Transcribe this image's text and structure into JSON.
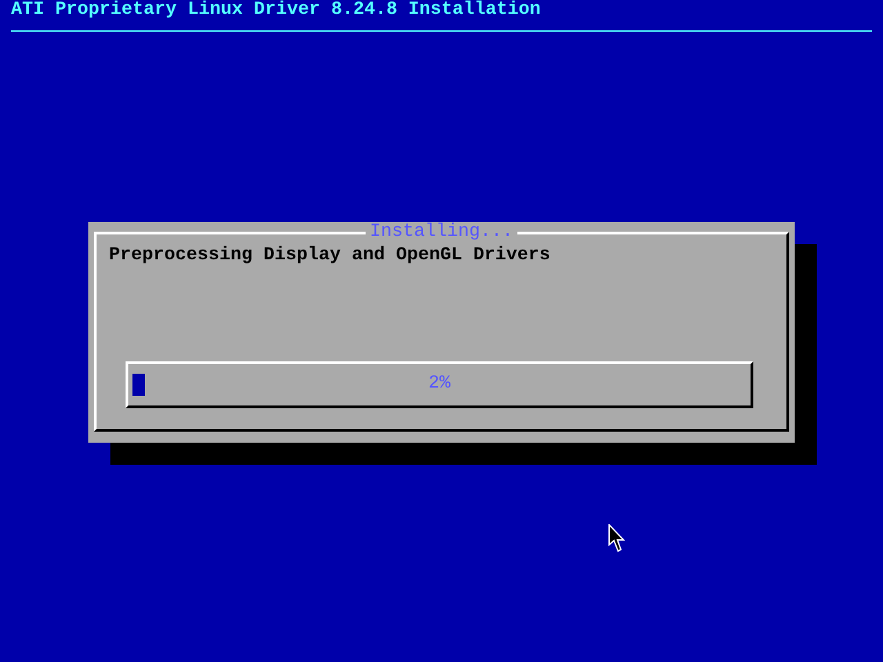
{
  "screen": {
    "title": "ATI Proprietary Linux Driver 8.24.8 Installation"
  },
  "dialog": {
    "title": "Installing...",
    "message": "Preprocessing Display and OpenGL Drivers",
    "progress": {
      "level": 0.02,
      "reading": "2%"
    }
  }
}
